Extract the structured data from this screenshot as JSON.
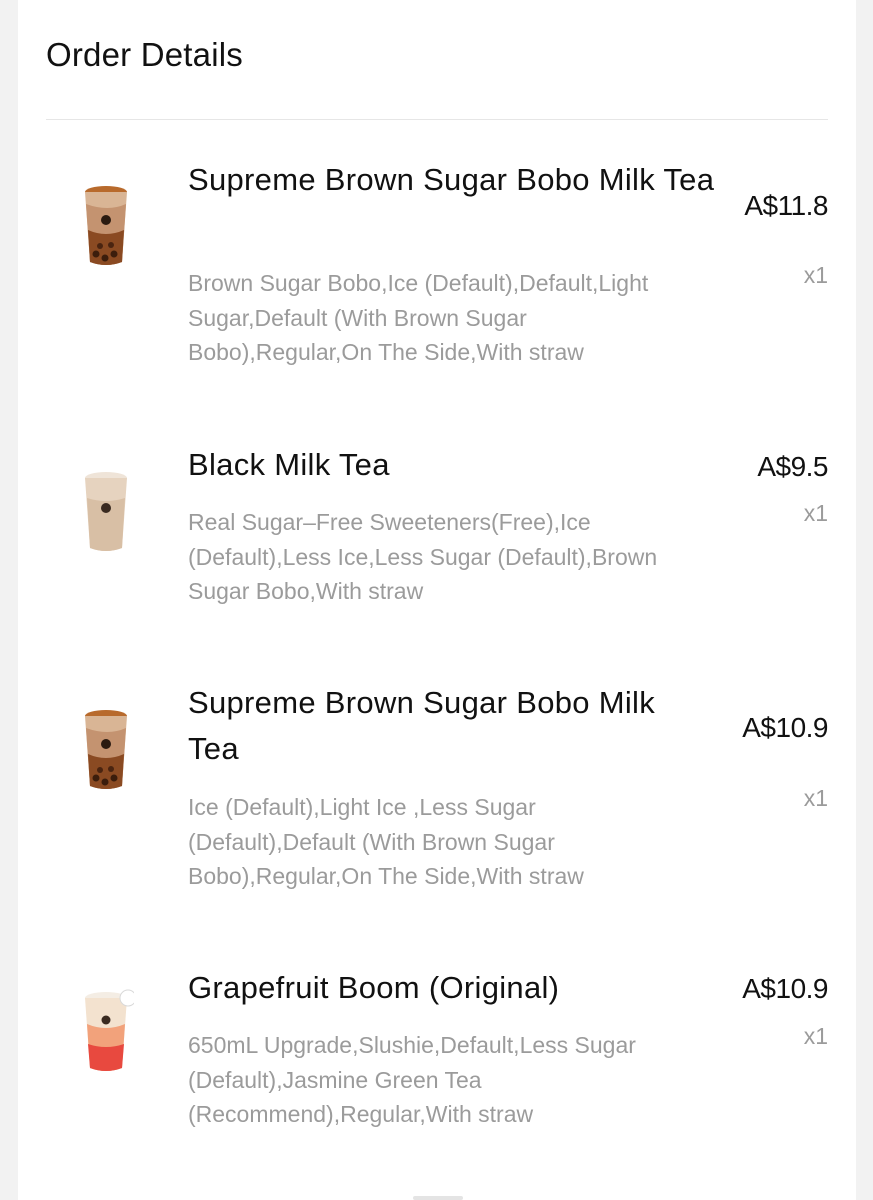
{
  "header": {
    "title": "Order Details"
  },
  "items": [
    {
      "name": "Supreme Brown Sugar Bobo Milk Tea",
      "options": "Brown Sugar Bobo,Ice (Default),Default,Light Sugar,Default (With Brown Sugar Bobo),Regular,On The Side,With straw",
      "price": "A$11.8",
      "qty": "x1",
      "drink_icon": "brown-sugar-milk-tea-cup-icon"
    },
    {
      "name": "Black Milk Tea",
      "options": "Real Sugar–Free Sweeteners(Free),Ice (Default),Less Ice,Less Sugar (Default),Brown Sugar Bobo,With straw",
      "price": "A$9.5",
      "qty": "x1",
      "drink_icon": "milk-tea-cup-icon"
    },
    {
      "name": "Supreme Brown Sugar Bobo Milk Tea",
      "options": "Ice (Default),Light Ice ,Less Sugar (Default),Default (With Brown Sugar Bobo),Regular,On The Side,With straw",
      "price": "A$10.9",
      "qty": "x1",
      "drink_icon": "brown-sugar-milk-tea-cup-icon"
    },
    {
      "name": "Grapefruit Boom (Original)",
      "options": "650mL Upgrade,Slushie,Default,Less Sugar (Default),Jasmine Green Tea (Recommend),Regular,With straw",
      "price": "A$10.9",
      "qty": "x1",
      "drink_icon": "grapefruit-cup-icon"
    }
  ],
  "colors": {
    "text_primary": "#111111",
    "text_secondary": "#9b9b9b",
    "divider": "#e6e6e6",
    "background": "#f2f2f2"
  }
}
